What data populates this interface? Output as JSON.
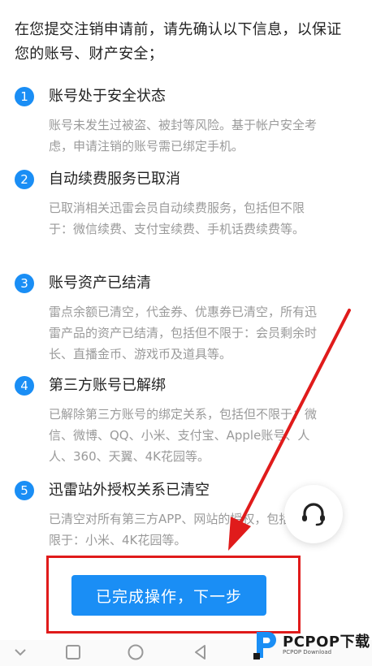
{
  "intro": "在您提交注销申请前，请先确认以下信息，以保证您的账号、财产安全；",
  "items": [
    {
      "num": "1",
      "title": "账号处于安全状态",
      "desc": "账号未发生过被盗、被封等风险。基于帐户安全考虑，申请注销的账号需已绑定手机。"
    },
    {
      "num": "2",
      "title": "自动续费服务已取消",
      "desc": "已取消相关迅雷会员自动续费服务，包括但不限于：微信续费、支付宝续费、手机话费续费等。"
    },
    {
      "num": "3",
      "title": "账号资产已结清",
      "desc": "雷点余额已清空，代金券、优惠券已清空，所有迅雷产品的资产已结清，包括但不限于：会员剩余时长、直播金币、游戏币及道具等。"
    },
    {
      "num": "4",
      "title": "第三方账号已解绑",
      "desc": "已解除第三方账号的绑定关系，包括但不限于：微信、微博、QQ、小米、支付宝、Apple账号、人人、360、天翼、4K花园等。"
    },
    {
      "num": "5",
      "title": "迅雷站外授权关系已清空",
      "desc": "已清空对所有第三方APP、网站的授权，包括但不限于：小米、4K花园等。"
    }
  ],
  "button": {
    "label": "已完成操作，下一步"
  },
  "watermark": {
    "brand": "PCPOP下载",
    "sub": "PCPOP Download"
  },
  "colors": {
    "accent": "#1a8ef5",
    "highlight": "#e01b1b"
  }
}
